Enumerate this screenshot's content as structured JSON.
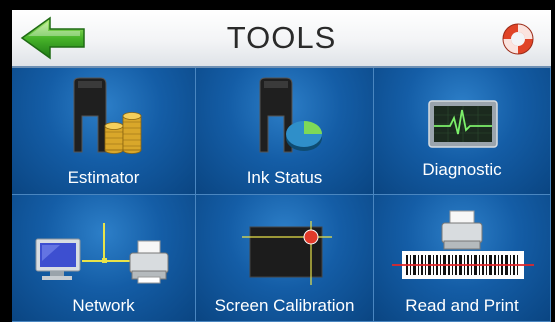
{
  "header": {
    "title": "TOOLS",
    "back_icon": "green-left-arrow",
    "help_icon": "lifebuoy"
  },
  "tools": [
    {
      "label": "Estimator",
      "icon": "cartridge-coins"
    },
    {
      "label": "Ink Status",
      "icon": "cartridge-pie"
    },
    {
      "label": "Diagnostic",
      "icon": "heartbeat-monitor"
    },
    {
      "label": "Network",
      "icon": "computer-network-printer"
    },
    {
      "label": "Screen Calibration",
      "icon": "crosshair-target"
    },
    {
      "label": "Read and Print",
      "icon": "barcode-printer"
    }
  ],
  "colors": {
    "tile": "#145da6",
    "background": "#0b3f77",
    "header": "#f3f4f6",
    "accent_green": "#3aa52c",
    "accent_red": "#e04427"
  }
}
